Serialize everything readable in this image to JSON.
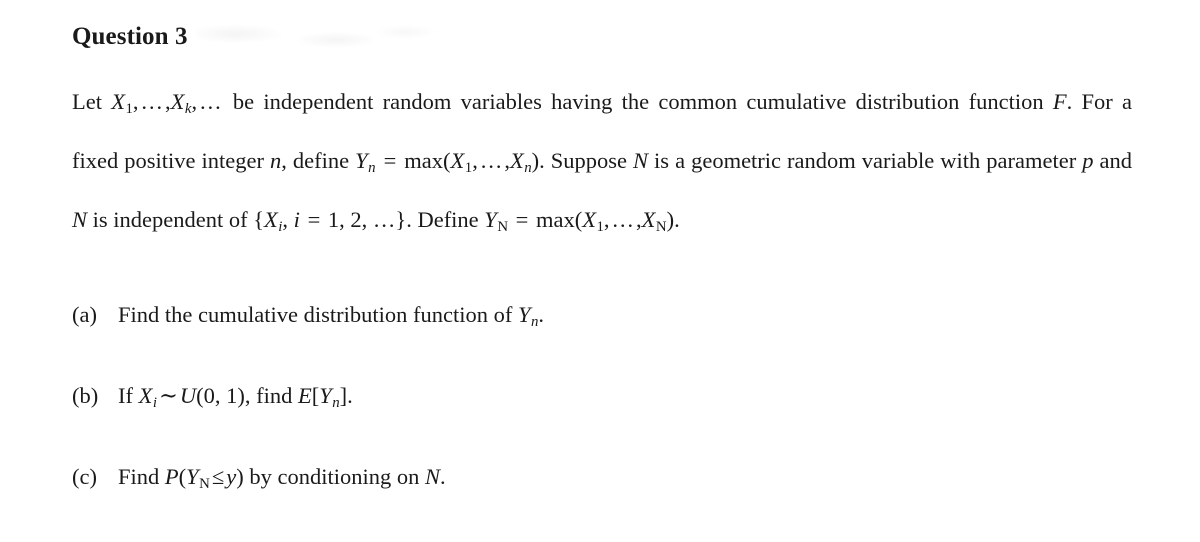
{
  "document": {
    "heading": "Question 3",
    "paragraph": {
      "lead": "Let ",
      "rv_list": "X₁,…,Xₖ,…",
      "text_1": " be independent random variables having the common cumulative distribution function ",
      "cdf_symbol": "F",
      "text_2": ". For a fixed positive integer ",
      "n_symbol": "n",
      "text_3": ", define ",
      "yn_def": "Yₙ = max(X₁,…,Xₙ)",
      "text_4": ". Suppose ",
      "N_symbol": "N",
      "text_5": " is a geometric random variable with parameter ",
      "p_symbol": "p",
      "text_6": " and ",
      "N_symbol_2": "N",
      "text_7": " is independent of ",
      "index_set": "{Xᵢ, i = 1, 2, …}",
      "text_8": ". Define ",
      "yN_def": "Yₙ = max(X₁,…,Xₙ)",
      "text_9": "."
    },
    "lines": [
      "Let X₁,…,Xₖ,… be independent random variables having the common cumulative",
      "distribution function F.  For a fixed positive integer n, define Yₙ = max(X₁,…,Xₙ).",
      "Suppose N is a geometric random variable with parameter p and N is independent of",
      "{Xᵢ, i = 1, 2, …}. Define Y_N = max(X₁,…,X_N)."
    ],
    "items": [
      {
        "marker": "(a)",
        "text": "Find the cumulative distribution function of Yₙ.",
        "parts": {
          "pre": "Find the cumulative distribution function of ",
          "var": "Y",
          "sub": "n",
          "post": "."
        }
      },
      {
        "marker": "(b)",
        "text": "If Xᵢ ∼ U(0, 1), find E[Yₙ].",
        "parts": {
          "pre": "If ",
          "var": "X",
          "sub": "i",
          "sim": "∼",
          "dist": "U",
          "dist_args": "(0, 1)",
          "mid": ", find ",
          "expectation": "E",
          "bracket_open": "[",
          "ex_var": "Y",
          "ex_sub": "n",
          "bracket_close": "]",
          "post": "."
        }
      },
      {
        "marker": "(c)",
        "text": "Find P(Y_N ≤ y) by conditioning on N.",
        "parts": {
          "pre": "Find ",
          "prob": "P",
          "paren_open": "(",
          "var": "Y",
          "sub": "N",
          "rel": "≤",
          "var2": "y",
          "paren_close": ")",
          "mid": " by conditioning on ",
          "cond_var": "N",
          "post": "."
        }
      }
    ]
  },
  "colors": {
    "page_background": "#ffffff",
    "text": "#1a1a1a"
  }
}
